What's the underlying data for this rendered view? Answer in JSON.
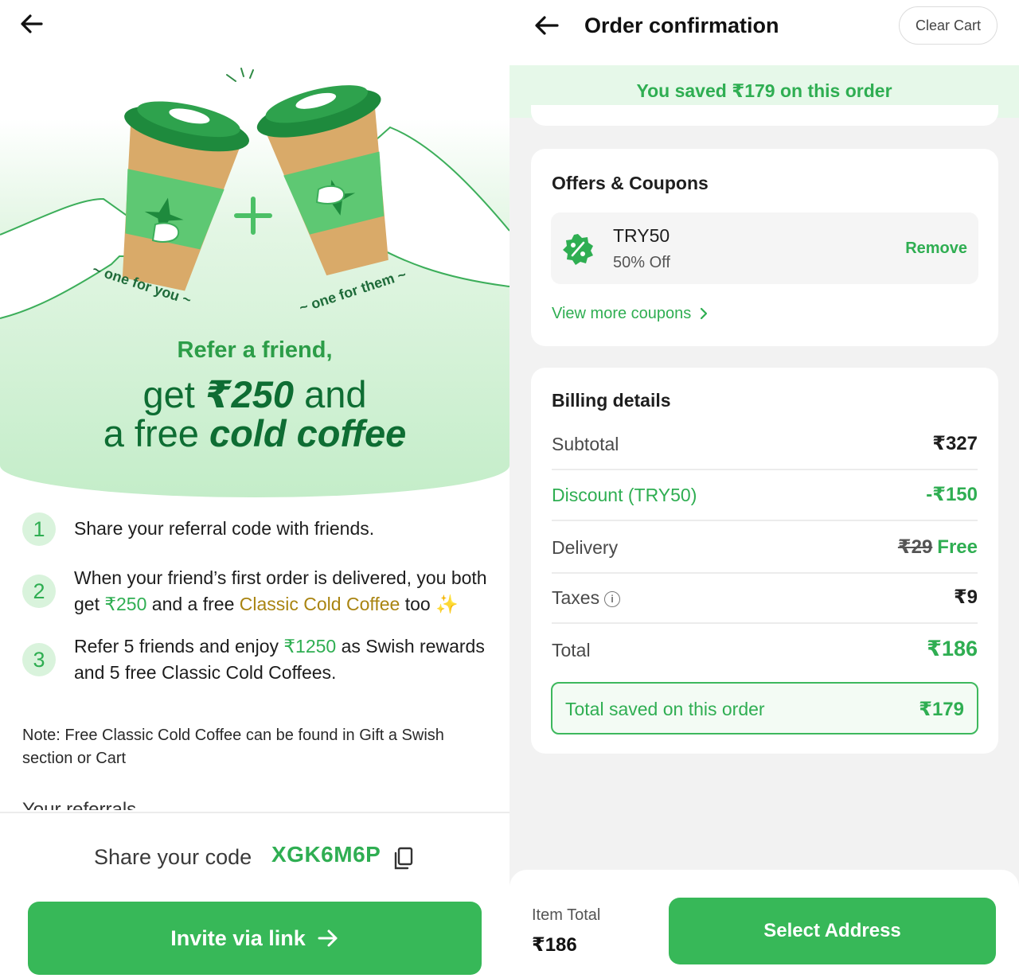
{
  "referral": {
    "illustration": {
      "left_caption": "~ one for you ~",
      "right_caption": "~ one for them ~"
    },
    "hero": {
      "title": "Refer a friend,",
      "line1_prefix": "get",
      "line1_amount": "₹250",
      "line1_suffix": "and",
      "line2_prefix": "a free",
      "line2_highlight": "cold coffee"
    },
    "steps": [
      {
        "num": "1",
        "text": "Share your referral code with friends."
      },
      {
        "num": "2",
        "text_a": "When your friend’s first order is delivered, you both get ",
        "amount": "₹250",
        "text_b": " and a free ",
        "product": "Classic Cold Coffee",
        "text_c": " too ",
        "sparkle": "✨"
      },
      {
        "num": "3",
        "text_a": "Refer 5 friends and enjoy ",
        "amount": "₹1250",
        "text_b": " as Swish rewards and 5 free Classic Cold Coffees."
      }
    ],
    "note": "Note: Free Classic Cold Coffee can be found in Gift a Swish section or Cart",
    "cut_off_text": "Your referrals",
    "share_label": "Share your code",
    "share_code": "XGK6M6P",
    "invite_button": "Invite via link",
    "colors": {
      "brand_green": "#37b858",
      "dark_green": "#0e6d33",
      "gold": "#a98411"
    },
    "icons": {
      "back": "arrow-left-icon",
      "copy": "copy-icon",
      "invite": "arrow-right-icon"
    }
  },
  "order": {
    "title": "Order confirmation",
    "clear_cart": "Clear Cart",
    "saved_banner": {
      "prefix": "You saved ",
      "amount": "₹179",
      "suffix": "  on this order"
    },
    "offers": {
      "title": "Offers & Coupons",
      "coupon_code": "TRY50",
      "coupon_desc": "50% Off",
      "remove": "Remove",
      "view_more": "View more coupons"
    },
    "billing": {
      "title": "Billing details",
      "rows": {
        "subtotal": {
          "label": "Subtotal",
          "value": "₹327"
        },
        "discount": {
          "label": "Discount (TRY50)",
          "value": "-₹150"
        },
        "delivery": {
          "label": "Delivery",
          "original": "₹29",
          "value": "Free"
        },
        "taxes": {
          "label": "Taxes",
          "value": "₹9"
        },
        "total": {
          "label": "Total",
          "value": "₹186"
        }
      },
      "total_saved": {
        "label": "Total saved on this order",
        "value": "₹179"
      }
    },
    "footer": {
      "item_total_label": "Item Total",
      "item_total_value": "₹186",
      "select_address": "Select Address"
    },
    "icons": {
      "back": "arrow-left-icon",
      "coupon": "percent-badge-icon",
      "info": "info-icon",
      "chevron": "chevron-right-icon"
    }
  }
}
